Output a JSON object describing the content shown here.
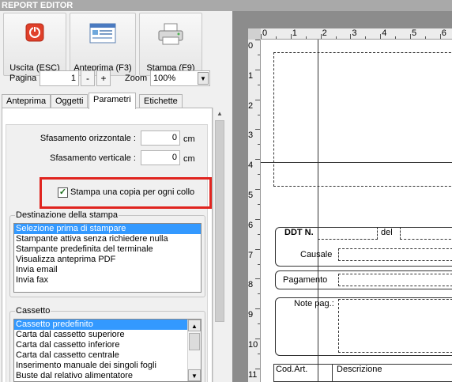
{
  "window": {
    "title": "REPORT EDITOR"
  },
  "toolbar": {
    "exit_label": "Uscita (ESC)",
    "preview_label": "Anteprima (F3)",
    "print_label": "Stampa (F9)"
  },
  "pagination": {
    "label": "Pagina",
    "value": "1",
    "minus": "-",
    "plus": "+",
    "zoom_label": "Zoom",
    "zoom_value": "100%"
  },
  "tabs": [
    "Anteprima",
    "Oggetti",
    "Parametri",
    "Etichette"
  ],
  "active_tab": "Parametri",
  "parametri": {
    "offset_h_label": "Sfasamento orizzontale :",
    "offset_h_value": "0",
    "offset_v_label": "Sfasamento verticale :",
    "offset_v_value": "0",
    "unit": "cm",
    "copy_per_package_label": "Stampa una copia per ogni collo",
    "copy_per_package_checked": true
  },
  "destinazione": {
    "title": "Destinazione della stampa",
    "items": [
      "Selezione prima di stampare",
      "Stampante attiva senza richiedere nulla",
      "Stampante predefinita del terminale",
      "Visualizza anteprima PDF",
      "Invia email",
      "Invia fax"
    ],
    "selected": 0
  },
  "cassetto": {
    "title": "Cassetto",
    "items": [
      "Cassetto predefinito",
      "Carta dal cassetto superiore",
      "Carta dal cassetto inferiore",
      "Carta dal cassetto centrale",
      "Inserimento manuale dei singoli fogli",
      "Buste dal relativo alimentatore"
    ],
    "selected": 0
  },
  "ruler": {
    "top_numbers": [
      "0",
      "1",
      "2",
      "3",
      "4",
      "5",
      "6"
    ],
    "left_numbers": [
      "0",
      "1",
      "2",
      "3",
      "4",
      "5",
      "6",
      "7",
      "8",
      "9",
      "10",
      "11"
    ]
  },
  "report": {
    "ddt_label": "DDT N.",
    "del_label": "del",
    "causale_label": "Causale",
    "pagamento_label": "Pagamento",
    "note_label": "Note pag.:",
    "codart_label": "Cod.Art.",
    "descrizione_label": "Descrizione"
  },
  "colors": {
    "highlight_border": "#e0241f",
    "selection": "#3399ff",
    "exit_icon": "#e0402a"
  },
  "icons": {
    "exit": "power-icon",
    "preview": "preview-window-icon",
    "print": "printer-icon"
  }
}
